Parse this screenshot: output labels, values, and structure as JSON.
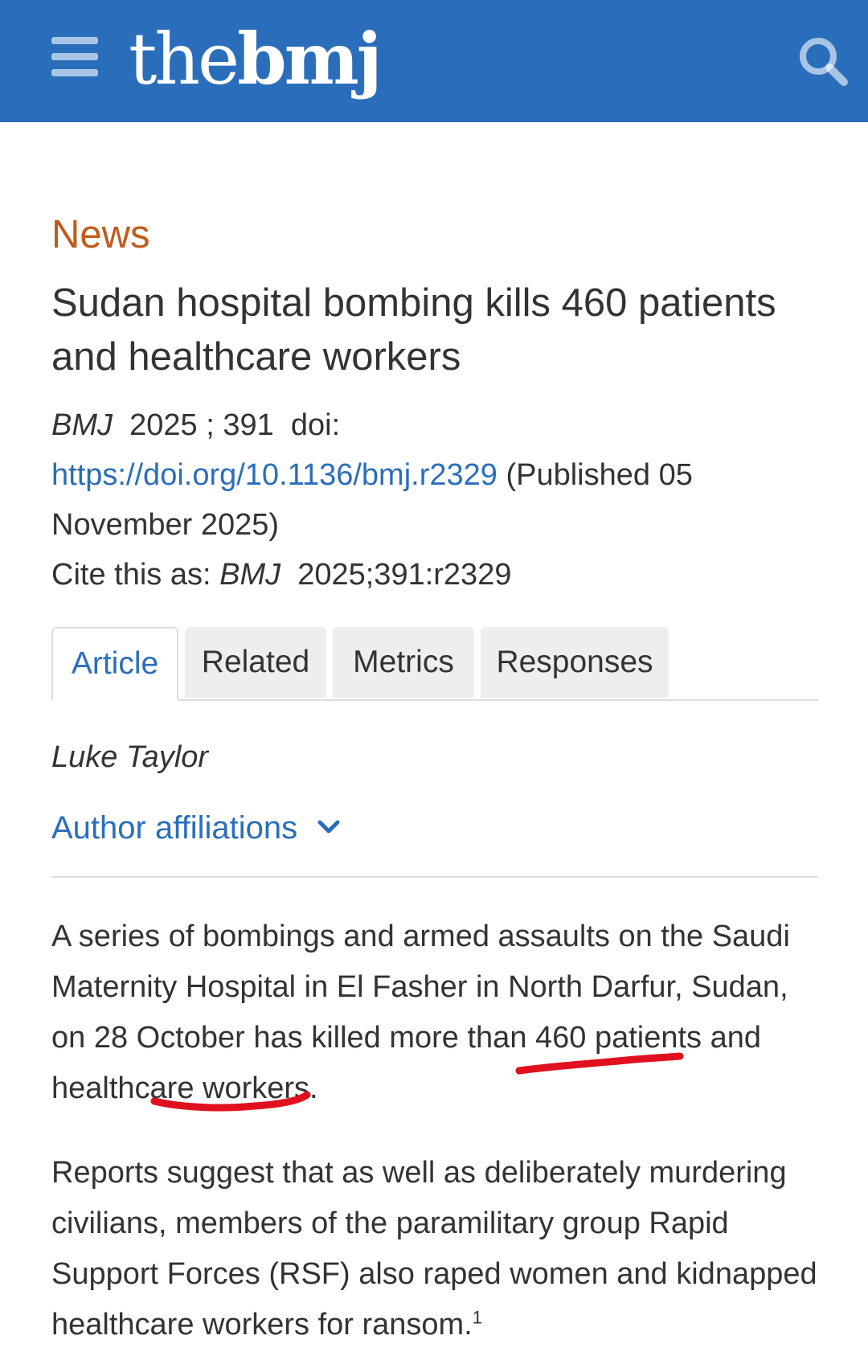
{
  "header": {
    "logo_light": "the",
    "logo_bold": "bmj",
    "menu_icon": "hamburger-menu-icon",
    "search_icon": "search-icon",
    "background_color": "#2a6ebb"
  },
  "article": {
    "section": "News",
    "title": "Sudan hospital bombing kills 460 patients and healthcare workers",
    "citation": {
      "journal": "BMJ",
      "year_volume": "2025 ; 391",
      "doi_label": "doi:",
      "doi_url": "https://doi.org/10.1136/bmj.r2329",
      "published": "(Published 05 November 2025)",
      "cite_prefix": "Cite this as:",
      "cite_journal": "BMJ",
      "cite_ref": "2025;391:r2329"
    },
    "tabs": [
      {
        "label": "Article",
        "active": true
      },
      {
        "label": "Related",
        "active": false
      },
      {
        "label": "Metrics",
        "active": false
      },
      {
        "label": "Responses",
        "active": false
      }
    ],
    "author": "Luke Taylor",
    "affiliations_label": "Author affiliations",
    "paragraphs": [
      {
        "before": "A series of bombings and armed assaults on the Saudi Maternity Hospital in El Fasher in North Darfur, Sudan, on 28 October has killed more than 460 patients and healthcare workers."
      },
      {
        "text": "Reports suggest that as well as deliberately murdering civilians, members of the paramilitary group Rapid Support Forces (RSF) also raped women and kidnapped healthcare workers for ransom.",
        "footnote": "1"
      }
    ]
  },
  "colors": {
    "accent_blue": "#2a6ebb",
    "section_orange": "#c05b1c",
    "annotation_red": "#e0101e"
  }
}
